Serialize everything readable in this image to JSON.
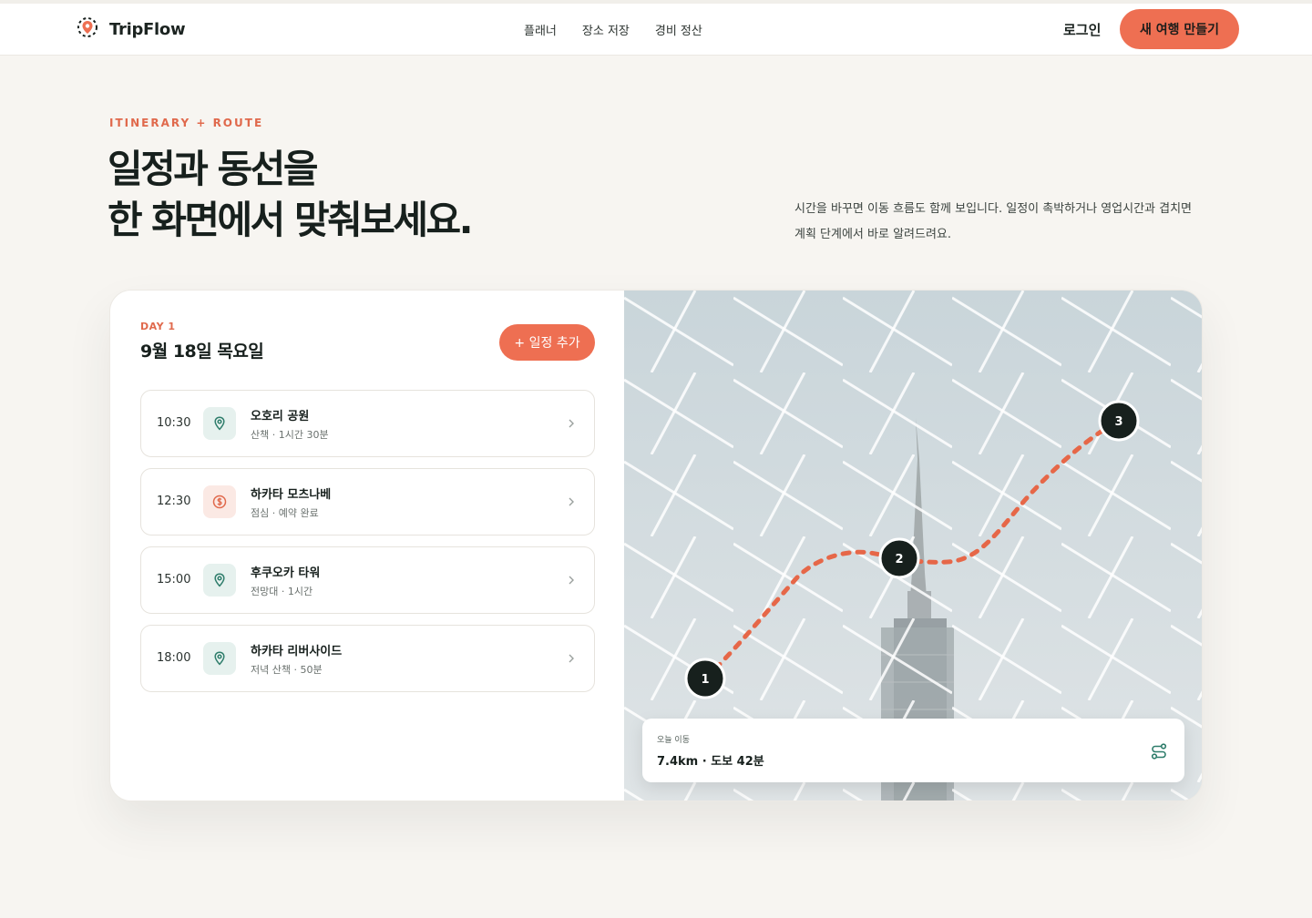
{
  "brand": {
    "name": "TripFlow",
    "logo_icon": "map-pin-route-icon",
    "accent": "#ee6f52",
    "teal": "#2e7d6b"
  },
  "nav": {
    "items": [
      {
        "label": "플래너"
      },
      {
        "label": "장소 저장"
      },
      {
        "label": "경비 정산"
      }
    ],
    "login_label": "로그인",
    "cta_label": "새 여행 만들기"
  },
  "hero": {
    "eyebrow": "ITINERARY + ROUTE",
    "title_lines": [
      "일정과 동선을",
      "한 화면에서 맞춰보세요."
    ],
    "description": "시간을 바꾸면 이동 흐름도 함께 보입니다. 일정이 촉박하거나 영업시간과 겹치면 계획 단계에서 바로 알려드려요."
  },
  "planner": {
    "day_label": "DAY 1",
    "date": "9월 18일 목요일",
    "add_label": "+ 일정 추가",
    "items": [
      {
        "time": "10:30",
        "icon": "map-pin-icon",
        "name": "오호리 공원",
        "meta": "산책 · 1시간 30분"
      },
      {
        "time": "12:30",
        "icon": "dollar-coin-icon",
        "name": "하카타 모츠나베",
        "meta": "점심 · 예약 완료"
      },
      {
        "time": "15:00",
        "icon": "map-pin-icon",
        "name": "후쿠오카 타워",
        "meta": "전망대 · 1시간"
      },
      {
        "time": "18:00",
        "icon": "map-pin-icon",
        "name": "하카타 리버사이드",
        "meta": "저녁 산책 · 50분"
      }
    ]
  },
  "map": {
    "markers": [
      "1",
      "2",
      "3"
    ],
    "summary_label": "오늘 이동",
    "summary_value": "7.4km · 도보 42분",
    "summary_icon": "route-icon"
  }
}
